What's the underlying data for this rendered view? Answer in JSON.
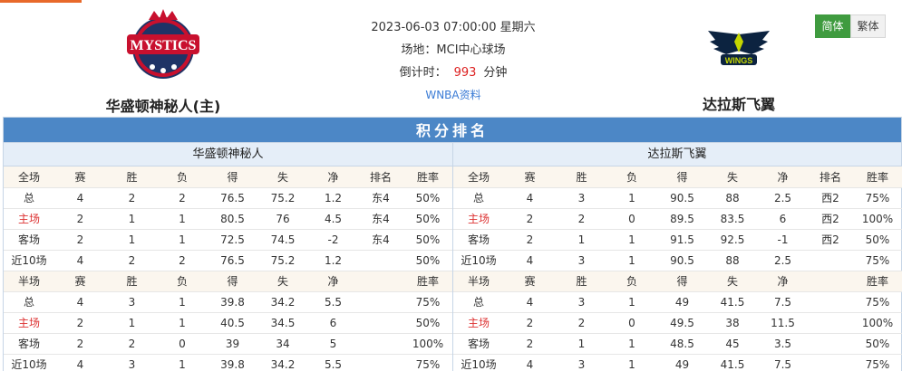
{
  "match": {
    "datetime": "2023-06-03 07:00:00 星期六",
    "venue": "场地：MCI中心球场",
    "countdown_label": "倒计时：",
    "countdown_value": "993",
    "countdown_unit": "分钟",
    "league_link": "WNBA资料"
  },
  "home_team": {
    "name": "华盛顿神秘人(主)",
    "logo_text": "MYSTICS"
  },
  "away_team": {
    "name": "达拉斯飞翼",
    "logo_text": "WINGS"
  },
  "lang": {
    "simplified": "简体",
    "traditional": "繁体"
  },
  "section_title": "积分排名",
  "colors": {
    "header_blue": "#4c87c6",
    "active_green": "#3f9b3f",
    "accent_red": "#dd3333"
  },
  "standings": [
    {
      "team": "华盛顿神秘人",
      "full_header": [
        "全场",
        "赛",
        "胜",
        "负",
        "得",
        "失",
        "净",
        "排名",
        "胜率"
      ],
      "full_rows": [
        [
          "总",
          "4",
          "2",
          "2",
          "76.5",
          "75.2",
          "1.2",
          "东4",
          "50%"
        ],
        [
          "主场",
          "2",
          "1",
          "1",
          "80.5",
          "76",
          "4.5",
          "东4",
          "50%"
        ],
        [
          "客场",
          "2",
          "1",
          "1",
          "72.5",
          "74.5",
          "-2",
          "东4",
          "50%"
        ],
        [
          "近10场",
          "4",
          "2",
          "2",
          "76.5",
          "75.2",
          "1.2",
          "",
          "50%"
        ]
      ],
      "half_header": [
        "半场",
        "赛",
        "胜",
        "负",
        "得",
        "失",
        "净",
        "",
        "胜率"
      ],
      "half_rows": [
        [
          "总",
          "4",
          "3",
          "1",
          "39.8",
          "34.2",
          "5.5",
          "",
          "75%"
        ],
        [
          "主场",
          "2",
          "1",
          "1",
          "40.5",
          "34.5",
          "6",
          "",
          "50%"
        ],
        [
          "客场",
          "2",
          "2",
          "0",
          "39",
          "34",
          "5",
          "",
          "100%"
        ],
        [
          "近10场",
          "4",
          "3",
          "1",
          "39.8",
          "34.2",
          "5.5",
          "",
          "75%"
        ]
      ]
    },
    {
      "team": "达拉斯飞翼",
      "full_header": [
        "全场",
        "赛",
        "胜",
        "负",
        "得",
        "失",
        "净",
        "排名",
        "胜率"
      ],
      "full_rows": [
        [
          "总",
          "4",
          "3",
          "1",
          "90.5",
          "88",
          "2.5",
          "西2",
          "75%"
        ],
        [
          "主场",
          "2",
          "2",
          "0",
          "89.5",
          "83.5",
          "6",
          "西2",
          "100%"
        ],
        [
          "客场",
          "2",
          "1",
          "1",
          "91.5",
          "92.5",
          "-1",
          "西2",
          "50%"
        ],
        [
          "近10场",
          "4",
          "3",
          "1",
          "90.5",
          "88",
          "2.5",
          "",
          "75%"
        ]
      ],
      "half_header": [
        "半场",
        "赛",
        "胜",
        "负",
        "得",
        "失",
        "净",
        "",
        "胜率"
      ],
      "half_rows": [
        [
          "总",
          "4",
          "3",
          "1",
          "49",
          "41.5",
          "7.5",
          "",
          "75%"
        ],
        [
          "主场",
          "2",
          "2",
          "0",
          "49.5",
          "38",
          "11.5",
          "",
          "100%"
        ],
        [
          "客场",
          "2",
          "1",
          "1",
          "48.5",
          "45",
          "3.5",
          "",
          "50%"
        ],
        [
          "近10场",
          "4",
          "3",
          "1",
          "49",
          "41.5",
          "7.5",
          "",
          "75%"
        ]
      ]
    }
  ]
}
